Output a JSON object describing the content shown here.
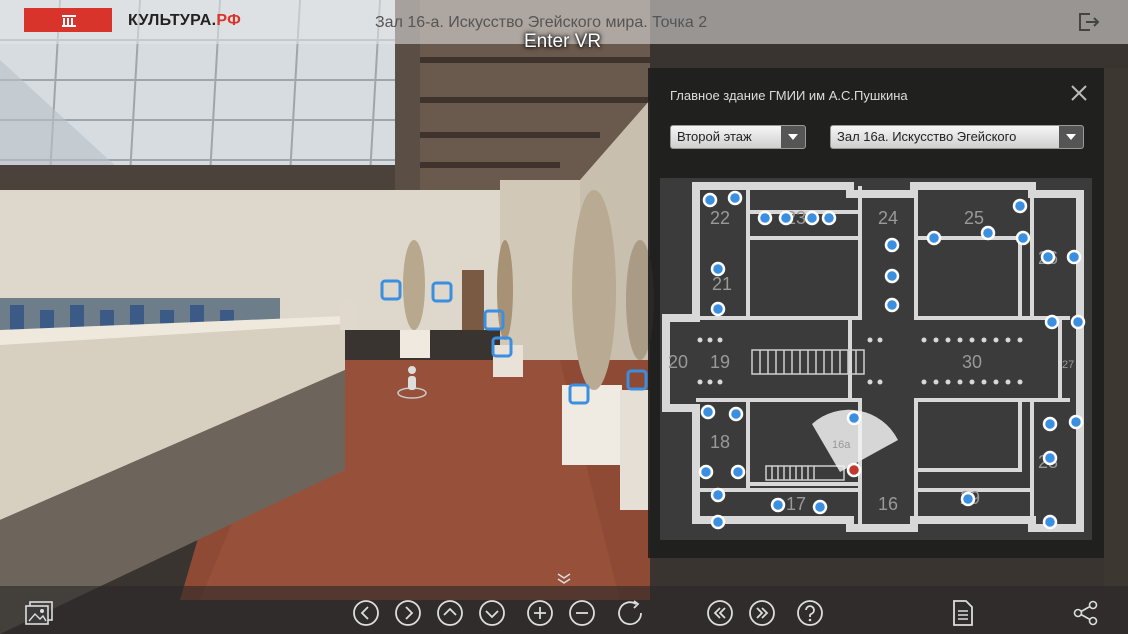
{
  "header": {
    "logo_text": "КУЛЬТУРА.",
    "logo_suffix": "РФ",
    "title": "Зал 16-а. Искусство Эгейского мира. Точка 2",
    "vr_label": "Enter VR"
  },
  "map": {
    "title": "Главное здание ГМИИ им А.С.Пушкина",
    "floor_select": "Второй этаж",
    "hall_select": "Зал 16а. Искусство Эгейского",
    "room_labels": [
      "22",
      "23",
      "24",
      "25",
      "26",
      "21",
      "20",
      "19",
      "30",
      "27",
      "18",
      "16а",
      "28",
      "17",
      "16",
      "29"
    ]
  },
  "colors": {
    "accent": "#d9342b",
    "hotspot": "#3b8fe0",
    "current_point": "#c0392b"
  },
  "icons": {
    "exit": "exit-icon",
    "close": "close-icon",
    "gallery": "gallery-icon",
    "left": "arrow-left-icon",
    "right": "arrow-right-icon",
    "up": "arrow-up-icon",
    "down": "arrow-down-icon",
    "zoom_in": "zoom-in-icon",
    "zoom_out": "zoom-out-icon",
    "rotate": "rotate-icon",
    "prev": "previous-point-icon",
    "next": "next-point-icon",
    "help": "help-icon",
    "info": "document-icon",
    "share": "share-icon"
  }
}
